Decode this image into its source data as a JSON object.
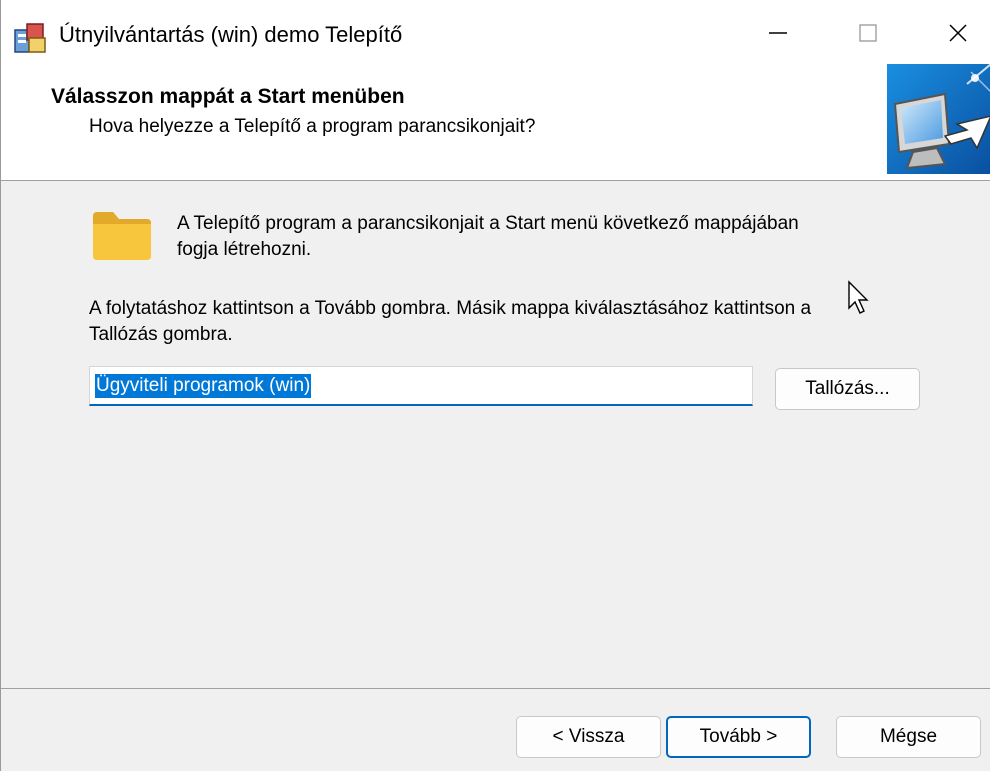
{
  "window": {
    "title": "Útnyilvántartás (win) demo Telepítő"
  },
  "header": {
    "title": "Válasszon mappát a Start menüben",
    "subtitle": "Hova helyezze a Telepítő a program parancsikonjait?"
  },
  "body": {
    "info_line1": "A Telepítő program a parancsikonjait a Start menü következő mappájában",
    "info_line2": "fogja létrehozni.",
    "instruction_line1": "A folytatáshoz kattintson a Tovább gombra. Másik mappa kiválasztásához kattintson a",
    "instruction_line2": "Tallózás gombra.",
    "folder_value": "Ügyviteli programok (win)",
    "browse_label": "Tallózás..."
  },
  "footer": {
    "back_label": "< Vissza",
    "next_label": "Tovább >",
    "cancel_label": "Mégse"
  },
  "icons": {
    "app": "installer-icon",
    "folder": "folder-icon",
    "wizard": "computer-install-icon"
  },
  "colors": {
    "accent": "#0067c0",
    "selection": "#0078d7",
    "folder": "#f8c63d",
    "background": "#f0f0f0"
  }
}
